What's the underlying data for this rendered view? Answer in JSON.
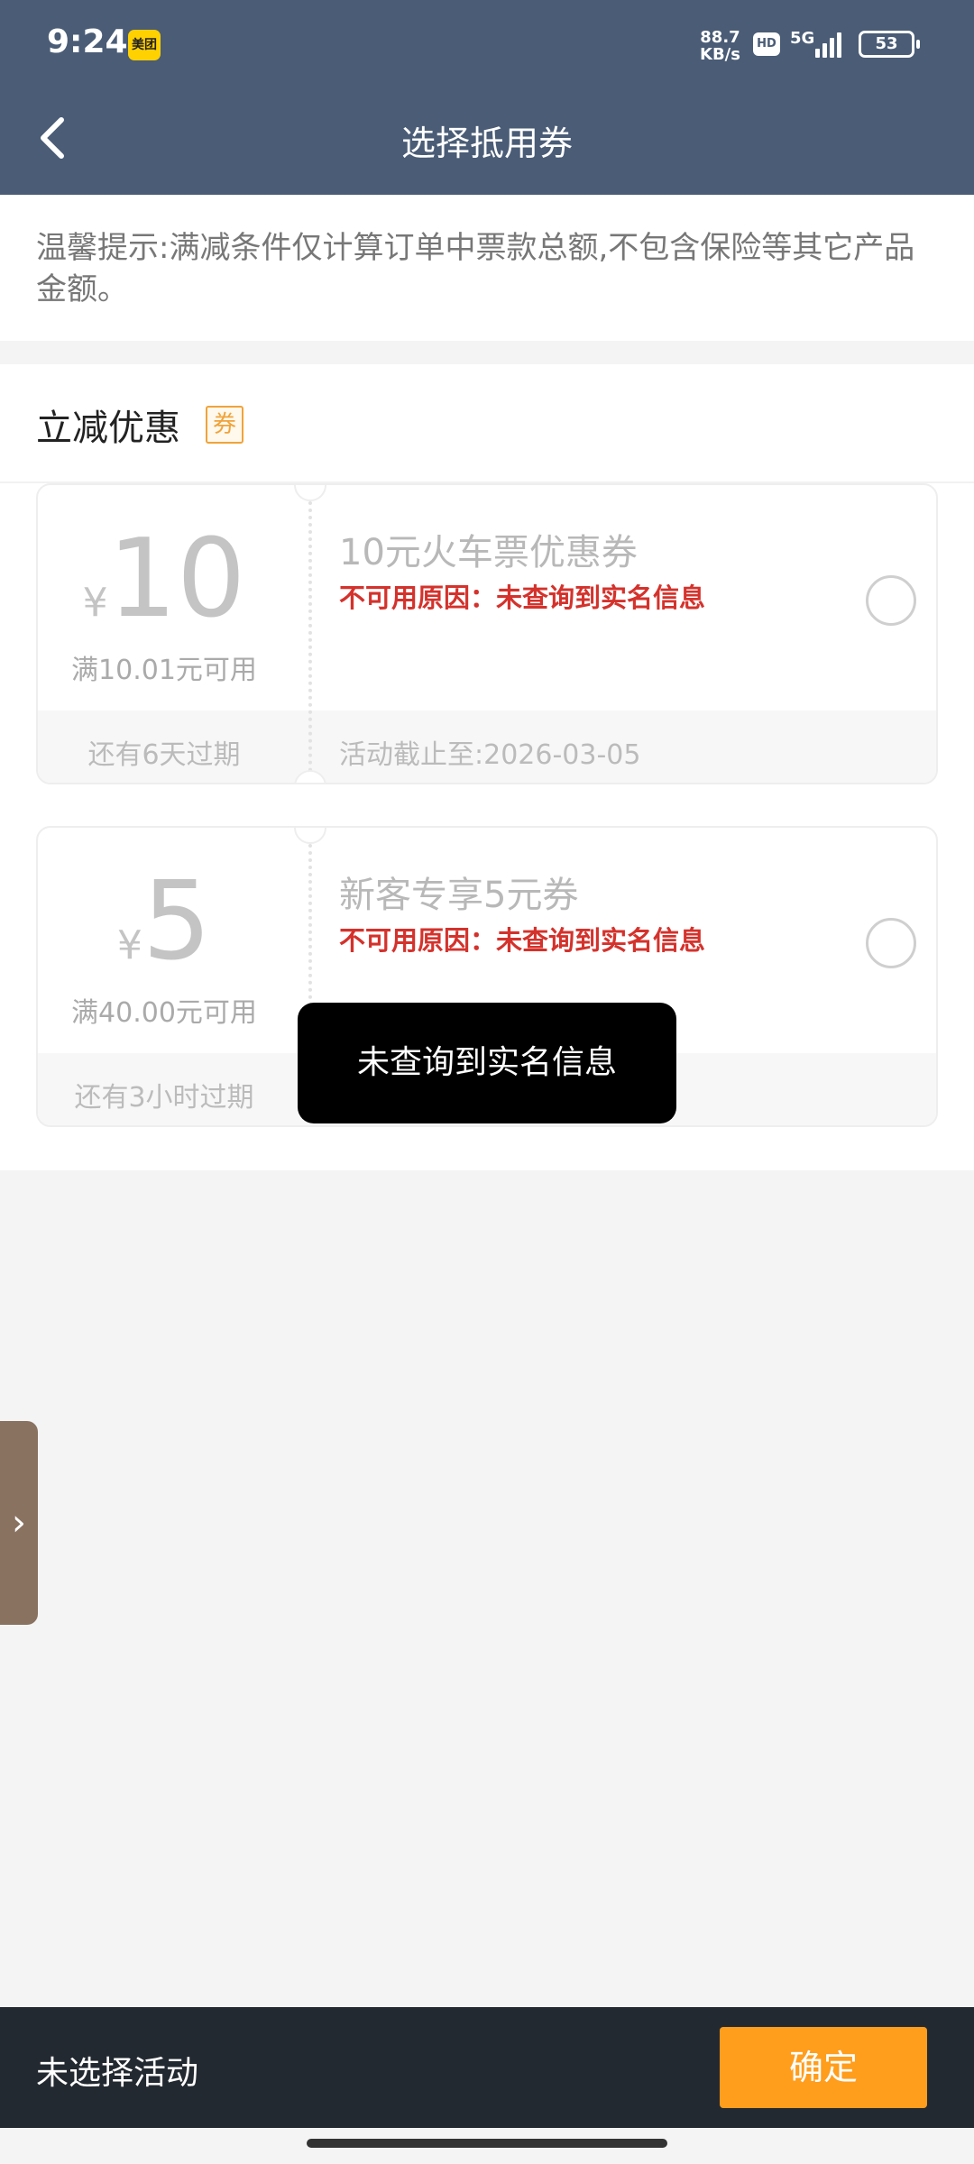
{
  "status_bar": {
    "time": "9:24",
    "app_badge": "美团",
    "speed_top": "88.7",
    "speed_bottom": "KB/s",
    "hd": "HD",
    "network": "5G",
    "battery": "53"
  },
  "header": {
    "title": "选择抵用券"
  },
  "tip": {
    "text": "温馨提示:满减条件仅计算订单中票款总额,不包含保险等其它产品金额。"
  },
  "section": {
    "title": "立减优惠",
    "badge": "券"
  },
  "coupons": [
    {
      "currency": "¥",
      "amount": "10",
      "condition": "满10.01元可用",
      "expire": "还有6天过期",
      "name": "10元火车票优惠券",
      "reason": "不可用原因：未查询到实名信息",
      "deadline": "活动截止至:2026-03-05"
    },
    {
      "currency": "¥",
      "amount": "5",
      "condition": "满40.00元可用",
      "expire": "还有3小时过期",
      "name": "新客专享5元券",
      "reason": "不可用原因：未查询到实名信息",
      "deadline": ""
    }
  ],
  "toast": {
    "text": "未查询到实名信息"
  },
  "side_tab": {
    "glyph": "›"
  },
  "footer": {
    "status": "未选择活动",
    "confirm_label": "确定"
  },
  "colors": {
    "header_bg": "#4a5c76",
    "accent": "#ff9d1c",
    "error": "#d4322c",
    "footer_bg": "#232931"
  }
}
